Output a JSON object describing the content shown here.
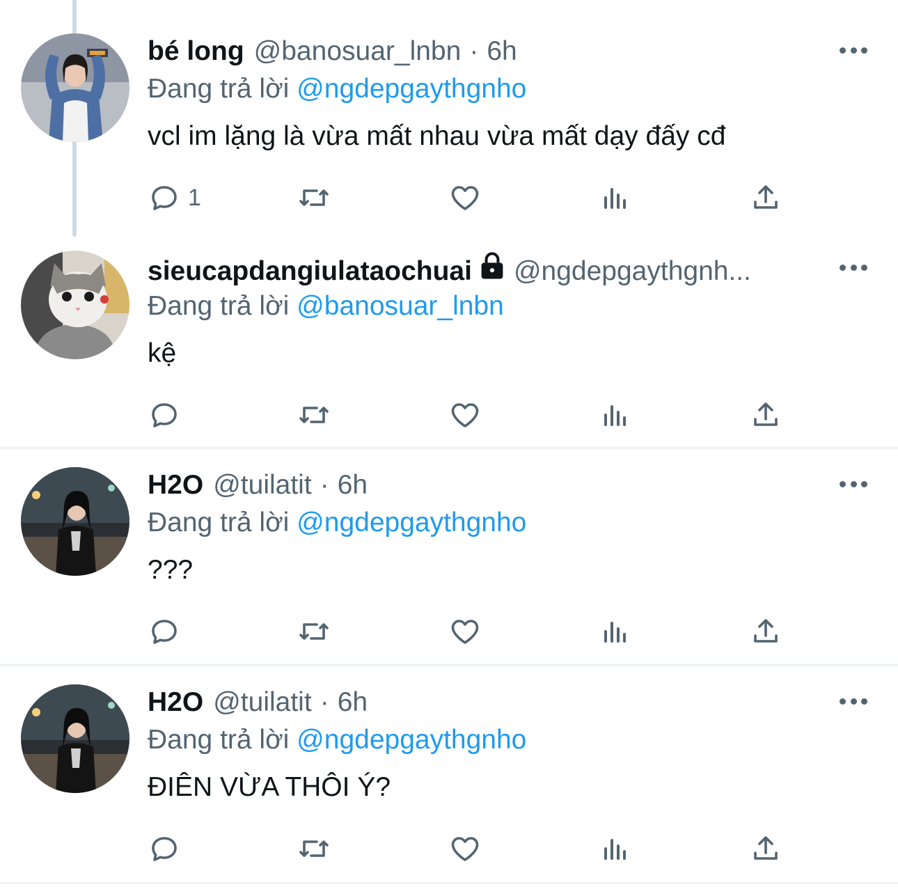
{
  "tweets": [
    {
      "name": "bé long",
      "handle": "@banosuar_lnbn",
      "dot": "·",
      "time": "6h",
      "reply_prefix": "Đang trả lời",
      "reply_to": "@ngdepgaythgnho",
      "text": "vcl im lặng là vừa mất nhau vừa mất dạy đấy cđ",
      "reply_count": "1",
      "avatar_icon": "profile-photo-girl-denim-jacket"
    },
    {
      "name": "sieucapdangiulataochuai",
      "handle": "@ngdepgaythgnh...",
      "locked": true,
      "reply_prefix": "Đang trả lời",
      "reply_to": "@banosuar_lnbn",
      "text": "kệ",
      "reply_count": "",
      "avatar_icon": "profile-photo-cat"
    },
    {
      "name": "H2O",
      "handle": "@tuilatit",
      "dot": "·",
      "time": "6h",
      "reply_prefix": "Đang trả lời",
      "reply_to": "@ngdepgaythgnho",
      "text": "???",
      "reply_count": "",
      "avatar_icon": "profile-photo-girl-night-street"
    },
    {
      "name": "H2O",
      "handle": "@tuilatit",
      "dot": "·",
      "time": "6h",
      "reply_prefix": "Đang trả lời",
      "reply_to": "@ngdepgaythgnho",
      "text": "ĐIÊN VỪA THÔI Ý?",
      "reply_count": "",
      "avatar_icon": "profile-photo-girl-night-street"
    }
  ],
  "colors": {
    "text": "#0f1419",
    "secondary": "#536471",
    "link": "#1d9bf0",
    "divider": "#eff3f4",
    "thread_line": "#cfd9de"
  }
}
